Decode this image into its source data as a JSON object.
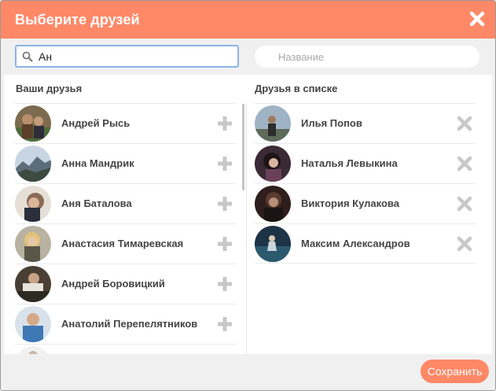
{
  "dialog": {
    "title": "Выберите друзей"
  },
  "search": {
    "value": "Ан"
  },
  "list_name": {
    "placeholder": "Название"
  },
  "left_column": {
    "title": "Ваши друзья",
    "items": [
      {
        "name": "Андрей Рысь"
      },
      {
        "name": "Анна Мандрик"
      },
      {
        "name": "Аня Баталова"
      },
      {
        "name": "Анастасия Тимаревская"
      },
      {
        "name": "Андрей Боровицкий"
      },
      {
        "name": "Анатолий Перепелятников"
      },
      {
        "name": ""
      }
    ]
  },
  "right_column": {
    "title": "Друзья в списке",
    "items": [
      {
        "name": "Илья Попов"
      },
      {
        "name": "Наталья Левыкина"
      },
      {
        "name": "Виктория Кулакова"
      },
      {
        "name": "Максим Александров"
      }
    ]
  },
  "footer": {
    "save_label": "Сохранить"
  },
  "colors": {
    "accent": "#ff8867",
    "focus_border": "#8ab4e8",
    "icon_gray": "#c8c8c8"
  }
}
